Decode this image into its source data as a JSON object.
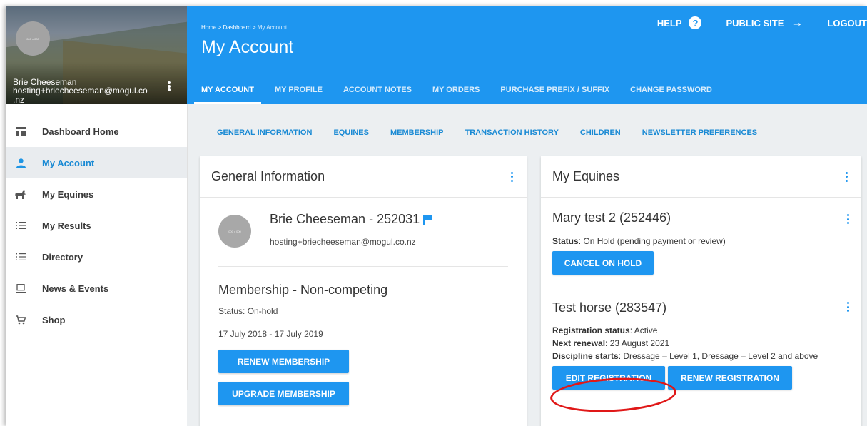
{
  "user": {
    "name": "Brie Cheeseman",
    "email_line1": "hosting+briecheeseman@mogul.co",
    "email_line2": ".nz",
    "avatar_text": "000 x 000"
  },
  "sidebar": {
    "items": [
      {
        "label": "Dashboard Home",
        "icon": "dashboard-icon",
        "glyph": "▪",
        "active": false
      },
      {
        "label": "My Account",
        "icon": "person-icon",
        "glyph": "●",
        "active": true
      },
      {
        "label": "My Equines",
        "icon": "horse-icon",
        "glyph": "♞",
        "active": false
      },
      {
        "label": "My Results",
        "icon": "numbered-list-icon",
        "glyph": "☰",
        "active": false
      },
      {
        "label": "Directory",
        "icon": "list-icon",
        "glyph": "☰",
        "active": false
      },
      {
        "label": "News & Events",
        "icon": "laptop-icon",
        "glyph": "▭",
        "active": false
      },
      {
        "label": "Shop",
        "icon": "cart-icon",
        "glyph": "🛒",
        "active": false
      }
    ]
  },
  "header": {
    "breadcrumb_home": "Home",
    "breadcrumb_dashboard": "Dashboard",
    "breadcrumb_current": "My Account",
    "breadcrumb_sep": ">",
    "title": "My Account",
    "help": "HELP",
    "help_glyph": "?",
    "public_site": "PUBLIC SITE",
    "public_site_glyph": "→",
    "logout": "LOGOUT",
    "tabs": [
      "MY ACCOUNT",
      "MY PROFILE",
      "ACCOUNT NOTES",
      "MY ORDERS",
      "PURCHASE PREFIX / SUFFIX",
      "CHANGE PASSWORD"
    ]
  },
  "subnav": [
    "GENERAL INFORMATION",
    "EQUINES",
    "MEMBERSHIP",
    "TRANSACTION HISTORY",
    "CHILDREN",
    "NEWSLETTER PREFERENCES"
  ],
  "general": {
    "title": "General Information",
    "name": "Brie Cheeseman - 252031",
    "email": "hosting+briecheeseman@mogul.co.nz",
    "membership_title": "Membership - Non-competing",
    "membership_status": "Status: On-hold",
    "membership_dates": "17 July 2018 - 17 July 2019",
    "renew_button": "RENEW MEMBERSHIP",
    "upgrade_button": "UPGRADE MEMBERSHIP"
  },
  "equines": {
    "title": "My Equines",
    "items": [
      {
        "name": "Mary test 2 (252446)",
        "status_label": "Status",
        "status_value": ": On Hold (pending payment or review)",
        "button": "CANCEL ON HOLD"
      },
      {
        "name": "Test horse (283547)",
        "reg_label": "Registration status",
        "reg_value": ": Active",
        "renewal_label": "Next renewal",
        "renewal_value": ": 23 August 2021",
        "discipline_label": "Discipline starts",
        "discipline_value": ": Dressage – Level 1, Dressage – Level 2 and above",
        "edit_button": "EDIT REGISTRATION",
        "renew_button": "RENEW REGISTRATION"
      }
    ]
  },
  "colors": {
    "primary": "#1e96f0",
    "highlight": "#e01818"
  }
}
